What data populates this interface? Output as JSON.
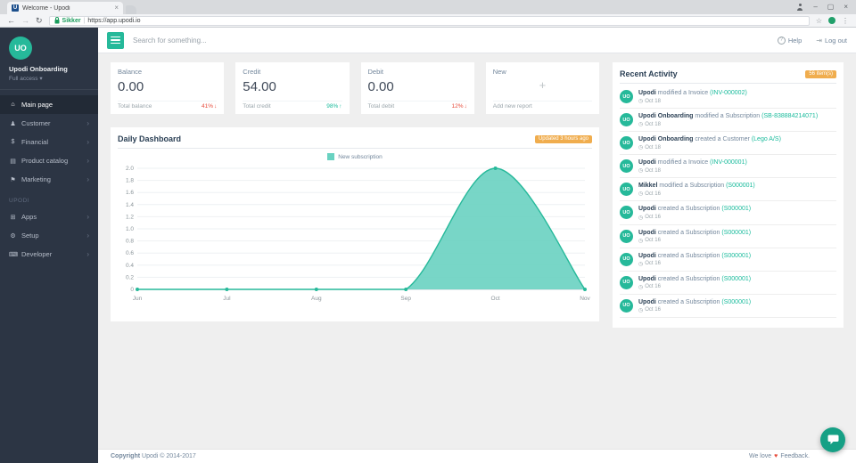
{
  "browser": {
    "tab_title": "Welcome - Upodi",
    "favicon_letter": "U",
    "security_label": "Sikker",
    "url": "https://app.upodi.io",
    "glyphs": {
      "back": "←",
      "forward": "→",
      "refresh": "↻",
      "minimize": "–",
      "maximize": "▢",
      "close": "×",
      "tab_close": "×",
      "star": "☆",
      "menu": "⋮"
    }
  },
  "sidebar": {
    "user": {
      "initials": "UO",
      "name": "Upodi Onboarding",
      "role": "Full access",
      "caret": "▾"
    },
    "chevron": "›",
    "menu": [
      {
        "label": "Main page",
        "glyph": "⌂"
      },
      {
        "label": "Customer",
        "glyph": "♟"
      },
      {
        "label": "Financial",
        "glyph": "$"
      },
      {
        "label": "Product catalog",
        "glyph": "▤"
      },
      {
        "label": "Marketing",
        "glyph": "⚑"
      }
    ],
    "section": "UPODI",
    "menu2": [
      {
        "label": "Apps",
        "glyph": "⊞"
      },
      {
        "label": "Setup",
        "glyph": "⚙"
      },
      {
        "label": "Developer",
        "glyph": "⌨"
      }
    ]
  },
  "topbar": {
    "search_placeholder": "Search for something...",
    "help_label": "Help",
    "help_glyph": "?",
    "logout_label": "Log out",
    "logout_glyph": "⇥"
  },
  "stats": [
    {
      "title": "Balance",
      "value": "0.00",
      "subtitle": "Total balance",
      "change": "41%",
      "arrow": "↓",
      "trend": "down"
    },
    {
      "title": "Credit",
      "value": "54.00",
      "subtitle": "Total credit",
      "change": "98%",
      "arrow": "↑",
      "trend": "up"
    },
    {
      "title": "Debit",
      "value": "0.00",
      "subtitle": "Total debit",
      "change": "12%",
      "arrow": "↓",
      "trend": "down"
    },
    {
      "title": "New",
      "plus": "+",
      "subtitle": "Add new report"
    }
  ],
  "dashboard": {
    "title": "Daily Dashboard",
    "updated_badge": "Updated 3 hours ago"
  },
  "chart_data": {
    "type": "area",
    "title": "Daily Dashboard",
    "categories": [
      "Jun",
      "Jul",
      "Aug",
      "Sep",
      "Oct",
      "Nov"
    ],
    "series": [
      {
        "name": "New subscription",
        "values": [
          0,
          0,
          0,
          0,
          2,
          0
        ]
      }
    ],
    "ylim": [
      0,
      2
    ],
    "ytick_step": 0.2,
    "grid": true,
    "legend_position": "top",
    "fill_color": "#69D2C1",
    "line_color": "#26B99A"
  },
  "activity": {
    "title": "Recent Activity",
    "badge": "56 item(s)",
    "clock_glyph": "◷",
    "items": [
      {
        "initials": "UO",
        "actor": "Upodi",
        "text": "modified a Invoice",
        "link": "(INV-000002)",
        "date": "Oct 18"
      },
      {
        "initials": "UO",
        "actor": "Upodi Onboarding",
        "text": "modified a Subscription",
        "link": "(SB-838884214071)",
        "date": "Oct 18"
      },
      {
        "initials": "UO",
        "actor": "Upodi Onboarding",
        "text": "created a Customer",
        "link": "(Lego A/S)",
        "date": "Oct 18"
      },
      {
        "initials": "UO",
        "actor": "Upodi",
        "text": "modified a Invoice",
        "link": "(INV-000001)",
        "date": "Oct 18"
      },
      {
        "initials": "UO",
        "actor": "Mikkel",
        "text": "modified a Subscription",
        "link": "(S000001)",
        "date": "Oct 16"
      },
      {
        "initials": "UO",
        "actor": "Upodi",
        "text": "created a Subscription",
        "link": "(S000001)",
        "date": "Oct 16"
      },
      {
        "initials": "UO",
        "actor": "Upodi",
        "text": "created a Subscription",
        "link": "(S000001)",
        "date": "Oct 16"
      },
      {
        "initials": "UO",
        "actor": "Upodi",
        "text": "created a Subscription",
        "link": "(S000001)",
        "date": "Oct 16"
      },
      {
        "initials": "UO",
        "actor": "Upodi",
        "text": "created a Subscription",
        "link": "(S000001)",
        "date": "Oct 16"
      },
      {
        "initials": "UO",
        "actor": "Upodi",
        "text": "created a Subscription",
        "link": "(S000001)",
        "date": "Oct 16"
      }
    ]
  },
  "footer": {
    "copyright_label": "Copyright",
    "copyright_text": "Upodi © 2014-2017",
    "love_text": "We love",
    "heart": "♥",
    "feedback_text": "Feedback."
  }
}
